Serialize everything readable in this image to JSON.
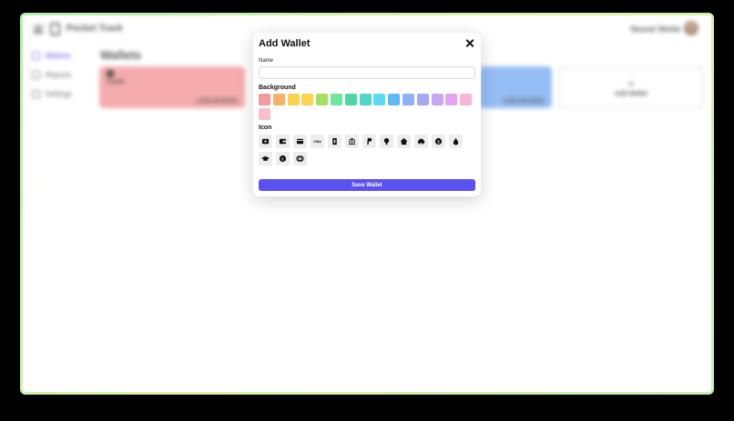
{
  "app": {
    "title": "Pocket Track",
    "user_name": "Naomi Webb"
  },
  "sidebar": {
    "items": [
      {
        "label": "Wallets",
        "active": true
      },
      {
        "label": "Reports",
        "active": false
      },
      {
        "label": "Settings",
        "active": false
      }
    ]
  },
  "main": {
    "title": "Wallets",
    "cards": [
      {
        "name": "Cash",
        "link": "+ Add transaction",
        "color": "#f59a9a"
      },
      {
        "name": "",
        "link": "+ Add transaction",
        "color": "#7fb0f5"
      }
    ],
    "add_card": {
      "plus": "+",
      "label": "Add Wallet"
    }
  },
  "modal": {
    "title": "Add Wallet",
    "name_label": "Name",
    "name_value": "",
    "name_placeholder": "",
    "background_label": "Background",
    "colors": [
      "#f59a9a",
      "#f7b267",
      "#fcd04b",
      "#fcd34d",
      "#a3e05d",
      "#6ee7a0",
      "#4ed6a4",
      "#4fd8c8",
      "#5ed7f0",
      "#60b8f5",
      "#8fb0f7",
      "#a6a9f7",
      "#c7a9f5",
      "#e3a3f5",
      "#f8b4d9",
      "#f9c0cc"
    ],
    "icon_label": "Icon",
    "icons": [
      "wallet-card-icon",
      "wallet-icon",
      "credit-card-icon",
      "visa-icon",
      "money-bill-icon",
      "bank-icon",
      "paypal-icon",
      "lightbulb-icon",
      "house-icon",
      "car-icon",
      "dollar-coin-icon",
      "droplet-icon",
      "graduation-cap-icon",
      "euro-coin-icon",
      "coins-icon"
    ],
    "save_label": "Save Wallet"
  }
}
